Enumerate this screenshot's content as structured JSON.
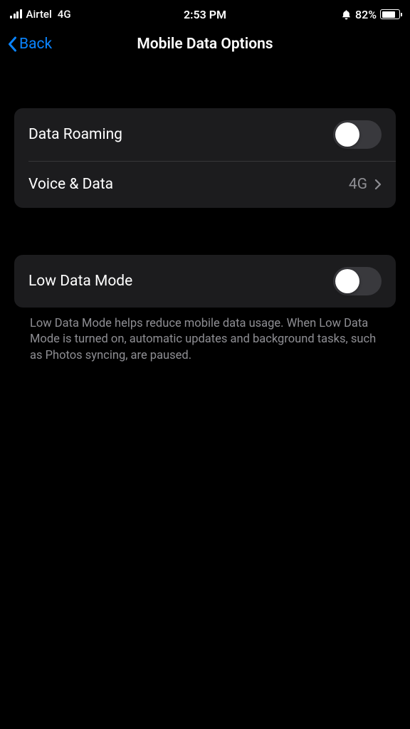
{
  "statusBar": {
    "carrier": "Airtel",
    "networkType": "4G",
    "time": "2:53 PM",
    "batteryPercent": "82%"
  },
  "nav": {
    "backLabel": "Back",
    "title": "Mobile Data Options"
  },
  "groups": [
    {
      "rows": [
        {
          "label": "Data Roaming",
          "type": "toggle",
          "on": false
        },
        {
          "label": "Voice & Data",
          "type": "nav",
          "value": "4G"
        }
      ]
    },
    {
      "rows": [
        {
          "label": "Low Data Mode",
          "type": "toggle",
          "on": false
        }
      ],
      "footer": "Low Data Mode helps reduce mobile data usage. When Low Data Mode is turned on, automatic updates and background tasks, such as Photos syncing, are paused."
    }
  ]
}
